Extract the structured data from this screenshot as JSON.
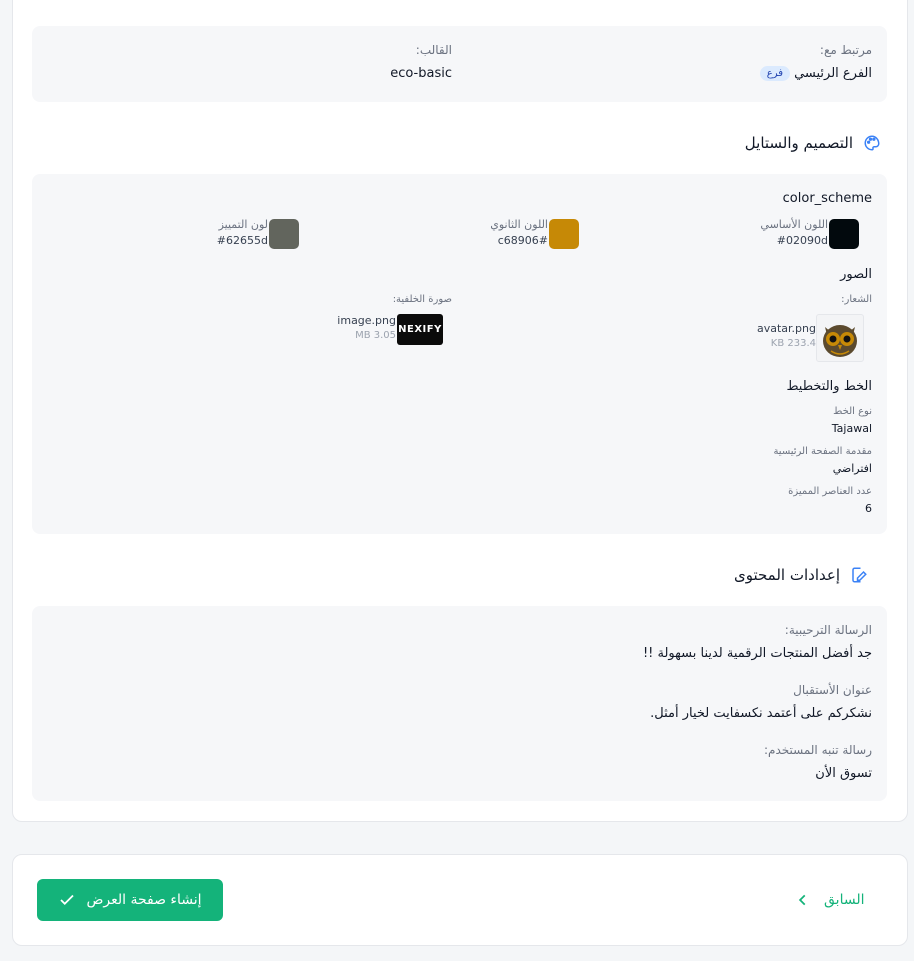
{
  "top_header_fragment": "... ...",
  "linkage": {
    "linked_label": "مرتبط مع:",
    "branch_name": "الفرع الرئيسي",
    "branch_badge": "فرع",
    "template_label": "القالب:",
    "template_value": "eco-basic"
  },
  "design": {
    "section_title": "التصميم والستايل",
    "color_scheme_label": "color_scheme",
    "colors": [
      {
        "label": "اللون الأساسي",
        "value": "#02090d",
        "hex": "#02090d"
      },
      {
        "label": "اللون الثانوي",
        "value": "c68906#",
        "hex": "#c68906"
      },
      {
        "label": "لون التمييز",
        "value": "#62655d",
        "hex": "#62655d"
      }
    ],
    "images_label": "الصور",
    "logo": {
      "label": "الشعار:",
      "filename": "avatar.png",
      "size": "KB 233.4"
    },
    "background": {
      "label": "صورة الخلفية:",
      "filename": "image.png",
      "size": "MB 3.05",
      "thumb_text": "NEXIFY"
    },
    "typography_label": "الخط والتخطيط",
    "font_label": "نوع الخط",
    "font_value": "Tajawal",
    "homepage_intro_label": "مقدمة الصفحة الرئيسية",
    "homepage_intro_value": "افتراضي",
    "featured_count_label": "عدد العناصر المميزة",
    "featured_count_value": "6"
  },
  "content": {
    "section_title": "إعدادات المحتوى",
    "welcome_label": "الرسالة الترحيبية:",
    "welcome_value": "جد أفضل المنتجات الرقمية لدينا بسهولة !!",
    "reception_label": "عنوان الأستقبال",
    "reception_value": "نشكركم على أعتمد نكسفايت لخيار أمثل.",
    "alert_label": "رسالة تنبه المستخدم:",
    "alert_value": "تسوق الأن"
  },
  "footer": {
    "create_button": "إنشاء صفحة العرض",
    "previous_button": "السابق"
  },
  "colors": {
    "accent": "#14b37a",
    "icon_blue": "#3b82f6"
  }
}
